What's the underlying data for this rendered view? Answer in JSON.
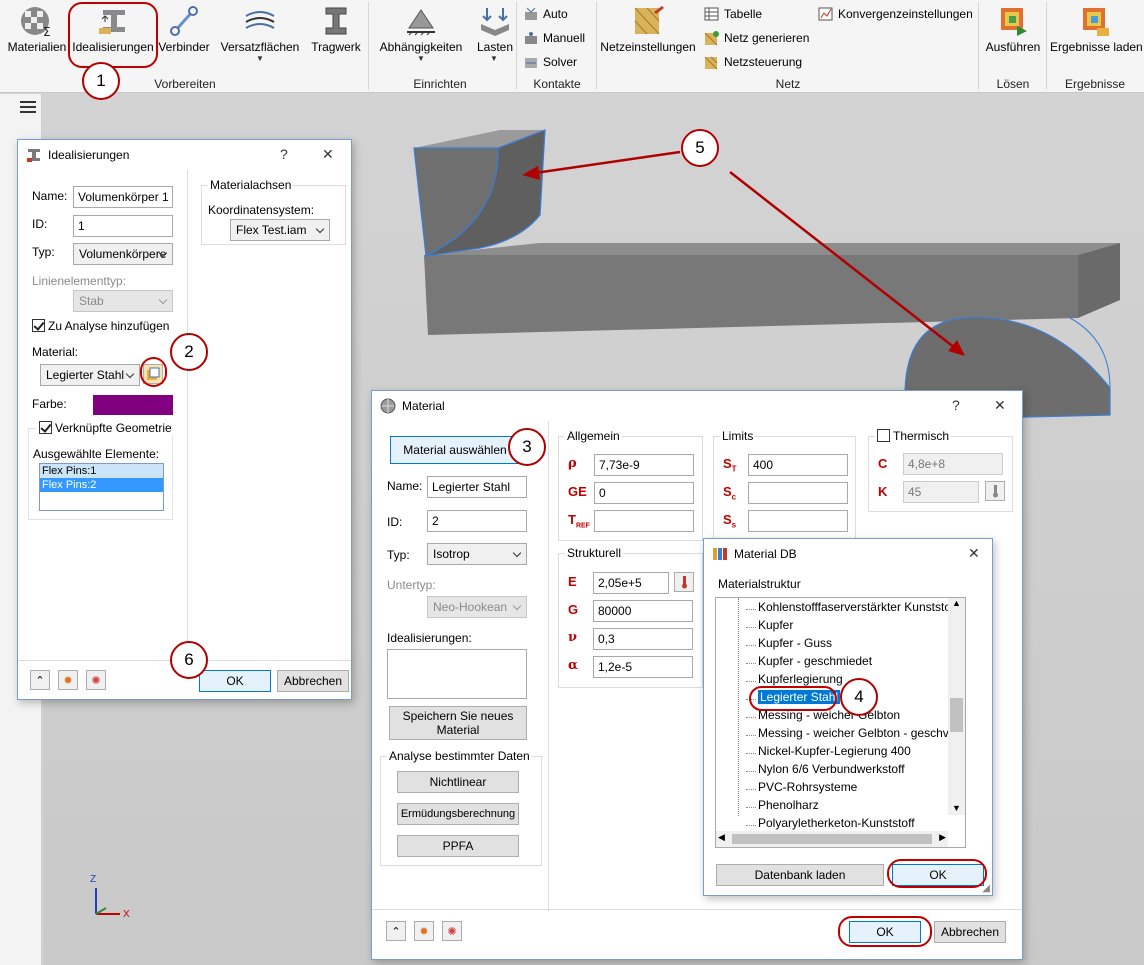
{
  "ribbon": {
    "buttons": {
      "materialien": "Materialien",
      "idealisierungen": "Idealisierungen",
      "verbinder": "Verbinder",
      "versatzflaechen": "Versatzflächen",
      "tragwerk": "Tragwerk",
      "abhaengigkeiten": "Abhängigkeiten",
      "lasten": "Lasten",
      "netzeinstellungen": "Netzeinstellungen",
      "ausfuehren": "Ausführen",
      "ergebnisse_laden": "Ergebnisse laden"
    },
    "kontakte": {
      "auto": "Auto",
      "manuell": "Manuell",
      "solver": "Solver"
    },
    "netz": {
      "tabelle": "Tabelle",
      "netz_generieren": "Netz generieren",
      "netzsteuerung": "Netzsteuerung",
      "konvergenz": "Konvergenzeinstellungen"
    },
    "groups": {
      "vorbereiten": "Vorbereiten",
      "einrichten": "Einrichten",
      "kontakte": "Kontakte",
      "netz": "Netz",
      "loesen": "Lösen",
      "ergebnisse": "Ergebnisse"
    }
  },
  "callouts": {
    "c1": "1",
    "c2": "2",
    "c3": "3",
    "c4": "4",
    "c5": "5",
    "c6": "6"
  },
  "ideal_dialog": {
    "title": "Idealisierungen",
    "help": "?",
    "close": "✕",
    "name_label": "Name:",
    "name_value": "Volumenkörper 1",
    "id_label": "ID:",
    "id_value": "1",
    "typ_label": "Typ:",
    "typ_value": "Volumenkörpere",
    "linien_label": "Linienelementtyp:",
    "linien_value": "Stab",
    "zu_analyse": "Zu Analyse hinzufügen",
    "material_label": "Material:",
    "material_value": "Legierter Stahl",
    "farbe_label": "Farbe:",
    "farbe_color": "#800080",
    "verknuepfte": "Verknüpfte Geometrie",
    "ausgewaehlte": "Ausgewählte Elemente:",
    "elemente": [
      "Flex Pins:1",
      "Flex Pins:2"
    ],
    "materialachsen": "Materialachsen",
    "koord_label": "Koordinatensystem:",
    "koord_value": "Flex Test.iam",
    "ok": "OK",
    "abbrechen": "Abbrechen"
  },
  "material_dialog": {
    "title": "Material",
    "help": "?",
    "close": "✕",
    "auswaehlen": "Material auswählen",
    "name_label": "Name:",
    "name_value": "Legierter Stahl",
    "id_label": "ID:",
    "id_value": "2",
    "typ_label": "Typ:",
    "typ_value": "Isotrop",
    "untertyp_label": "Untertyp:",
    "untertyp_value": "Neo-Hookean",
    "ideal_label": "Idealisierungen:",
    "speichern": "Speichern Sie neues Material",
    "analyse_group": "Analyse bestimmter Daten",
    "nichtlinear": "Nichtlinear",
    "ermuedung": "Ermüdungsberechnung",
    "ppfa": "PPFA",
    "allgemein": "Allgemein",
    "rho": "ρ",
    "rho_value": "7,73e-9",
    "ge": "GE",
    "ge_value": "0",
    "tref_value": "",
    "limits": "Limits",
    "st_value": "400",
    "sc_value": "",
    "ss_value": "",
    "thermisch": "Thermisch",
    "c_label": "C",
    "c_value": "4,8e+8",
    "k_label": "K",
    "k_value": "45",
    "strukturell": "Strukturell",
    "e_label": "E",
    "e_value": "2,05e+5",
    "g_label": "G",
    "g_value": "80000",
    "nu": "ν",
    "nu_value": "0,3",
    "alpha": "α",
    "alpha_value": "1,2e-5",
    "ok": "OK",
    "abbrechen": "Abbrechen"
  },
  "matdb_dialog": {
    "title": "Material DB",
    "close": "✕",
    "struktur": "Materialstruktur",
    "items": [
      "Kohlenstofffaserverstärkter Kunststo",
      "Kupfer",
      "Kupfer - Guss",
      "Kupfer - geschmiedet",
      "Kupferlegierung",
      "Legierter Stahl",
      "Messing - weicher Gelbton",
      "Messing - weicher Gelbton - geschv",
      "Nickel-Kupfer-Legierung 400",
      "Nylon 6/6 Verbundwerkstoff",
      "PVC-Rohrsysteme",
      "Phenolharz",
      "Polyaryletherketon-Kunststoff"
    ],
    "selected_index": 5,
    "datenbank_laden": "Datenbank laden",
    "ok": "OK"
  },
  "axes": {
    "z": "Z",
    "x": "X"
  },
  "colors": {
    "accent_red": "#c00000",
    "selection_blue": "#0078d7",
    "purple": "#800080"
  }
}
